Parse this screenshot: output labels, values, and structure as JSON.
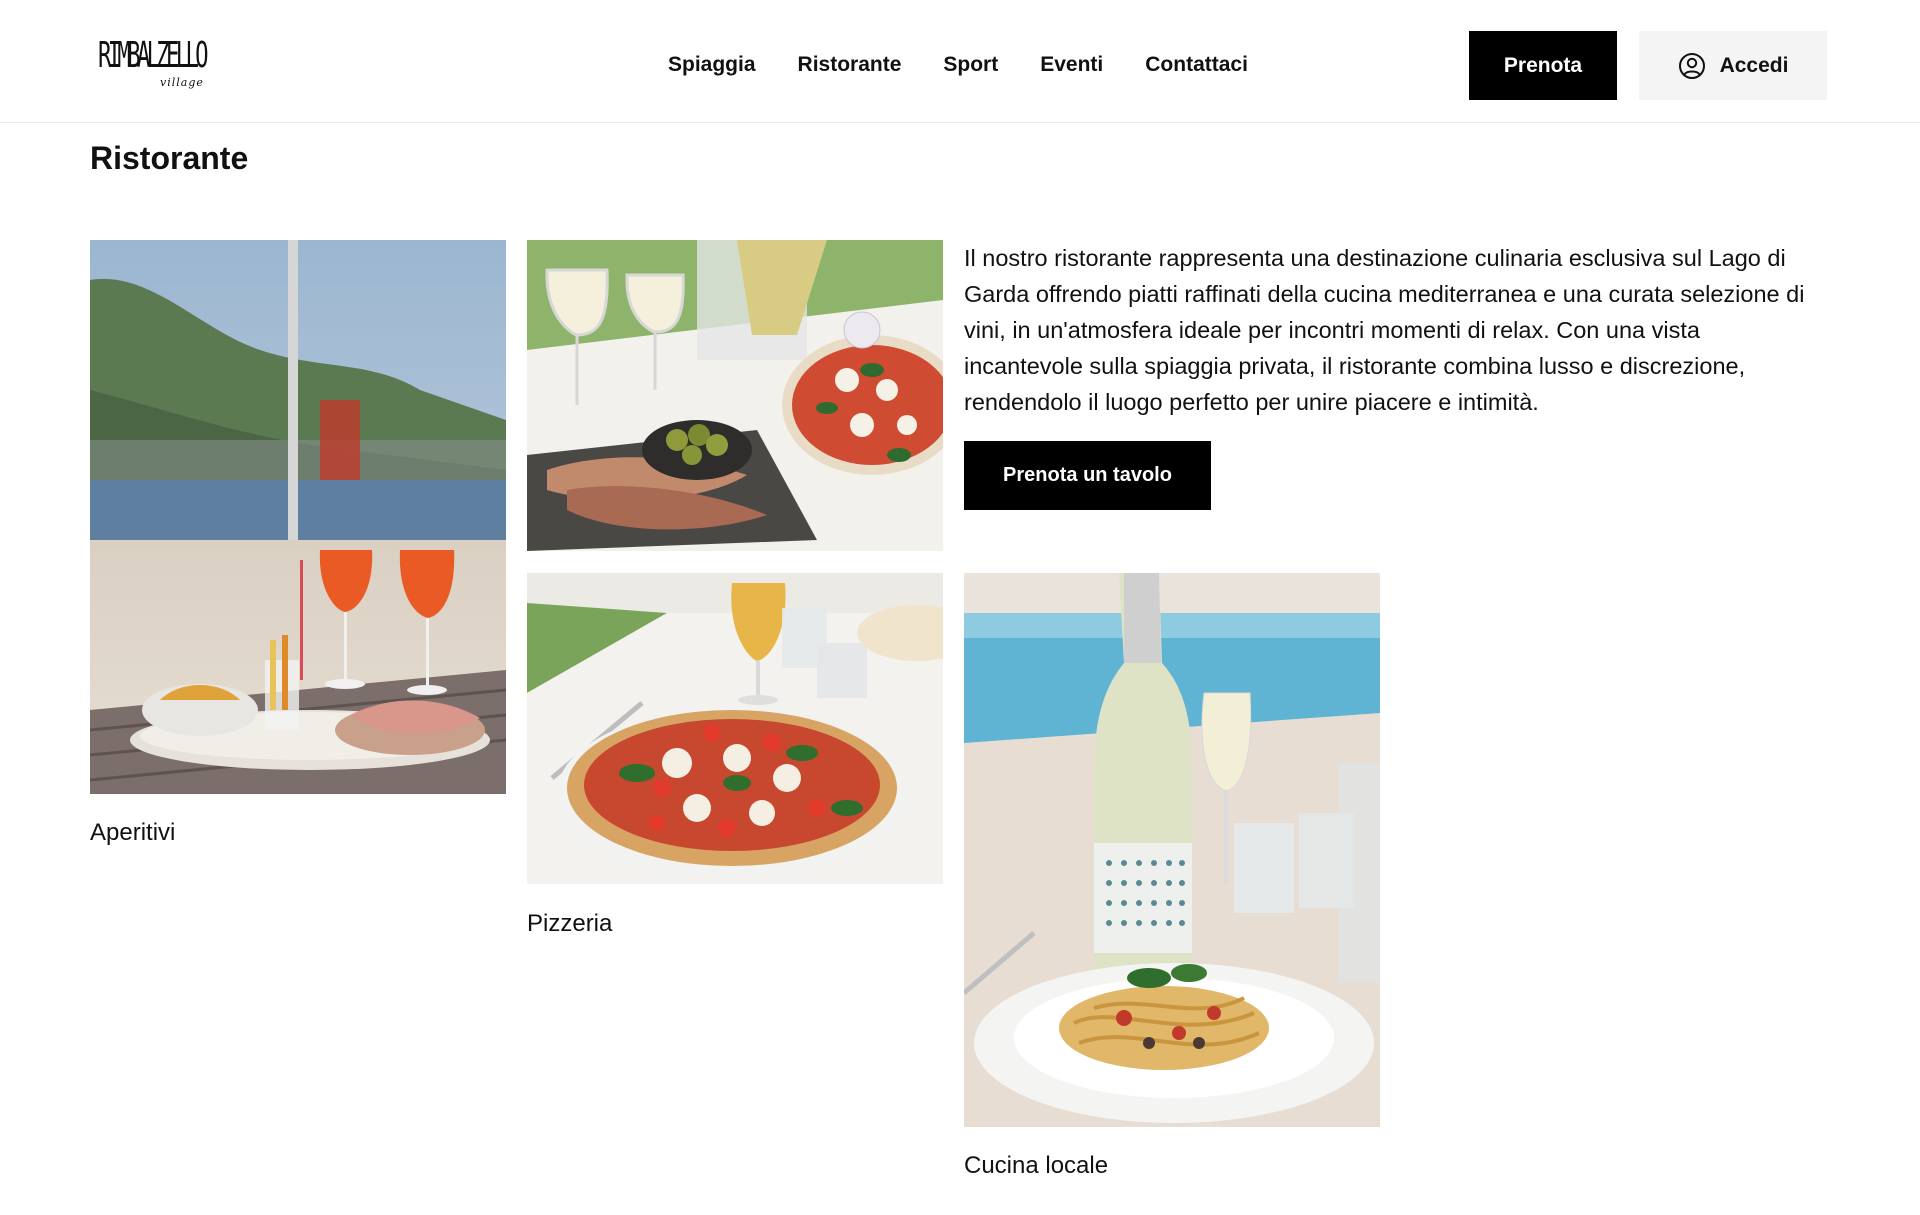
{
  "header": {
    "logo": {
      "text": "RIMBALZELLO",
      "subtext": "village"
    },
    "nav": [
      {
        "label": "Spiaggia"
      },
      {
        "label": "Ristorante"
      },
      {
        "label": "Sport"
      },
      {
        "label": "Eventi"
      },
      {
        "label": "Contattaci"
      }
    ],
    "book_button": "Prenota",
    "login_button": "Accedi"
  },
  "main": {
    "title": "Ristorante",
    "description": "Il nostro ristorante rappresenta una destinazione culinaria esclusiva sul Lago di Garda offrendo piatti raffinati della cucina mediterranea e una curata selezione di vini, in un'atmosfera ideale per incontri momenti di relax. Con una vista incantevole sulla spiaggia privata, il ristorante combina lusso e discrezione, rendendolo il luogo perfetto per unire piacere e intimità.",
    "cta_button": "Prenota un tavolo",
    "cards": [
      {
        "label": "Aperitivi"
      },
      {
        "label": "Pizzeria"
      },
      {
        "label": "Cucina locale"
      }
    ]
  },
  "colors": {
    "primary": "#000000",
    "secondary_button_bg": "#f4f4f4",
    "text": "#111111",
    "background": "#ffffff"
  },
  "icons": {
    "login": "user-circle-icon"
  }
}
